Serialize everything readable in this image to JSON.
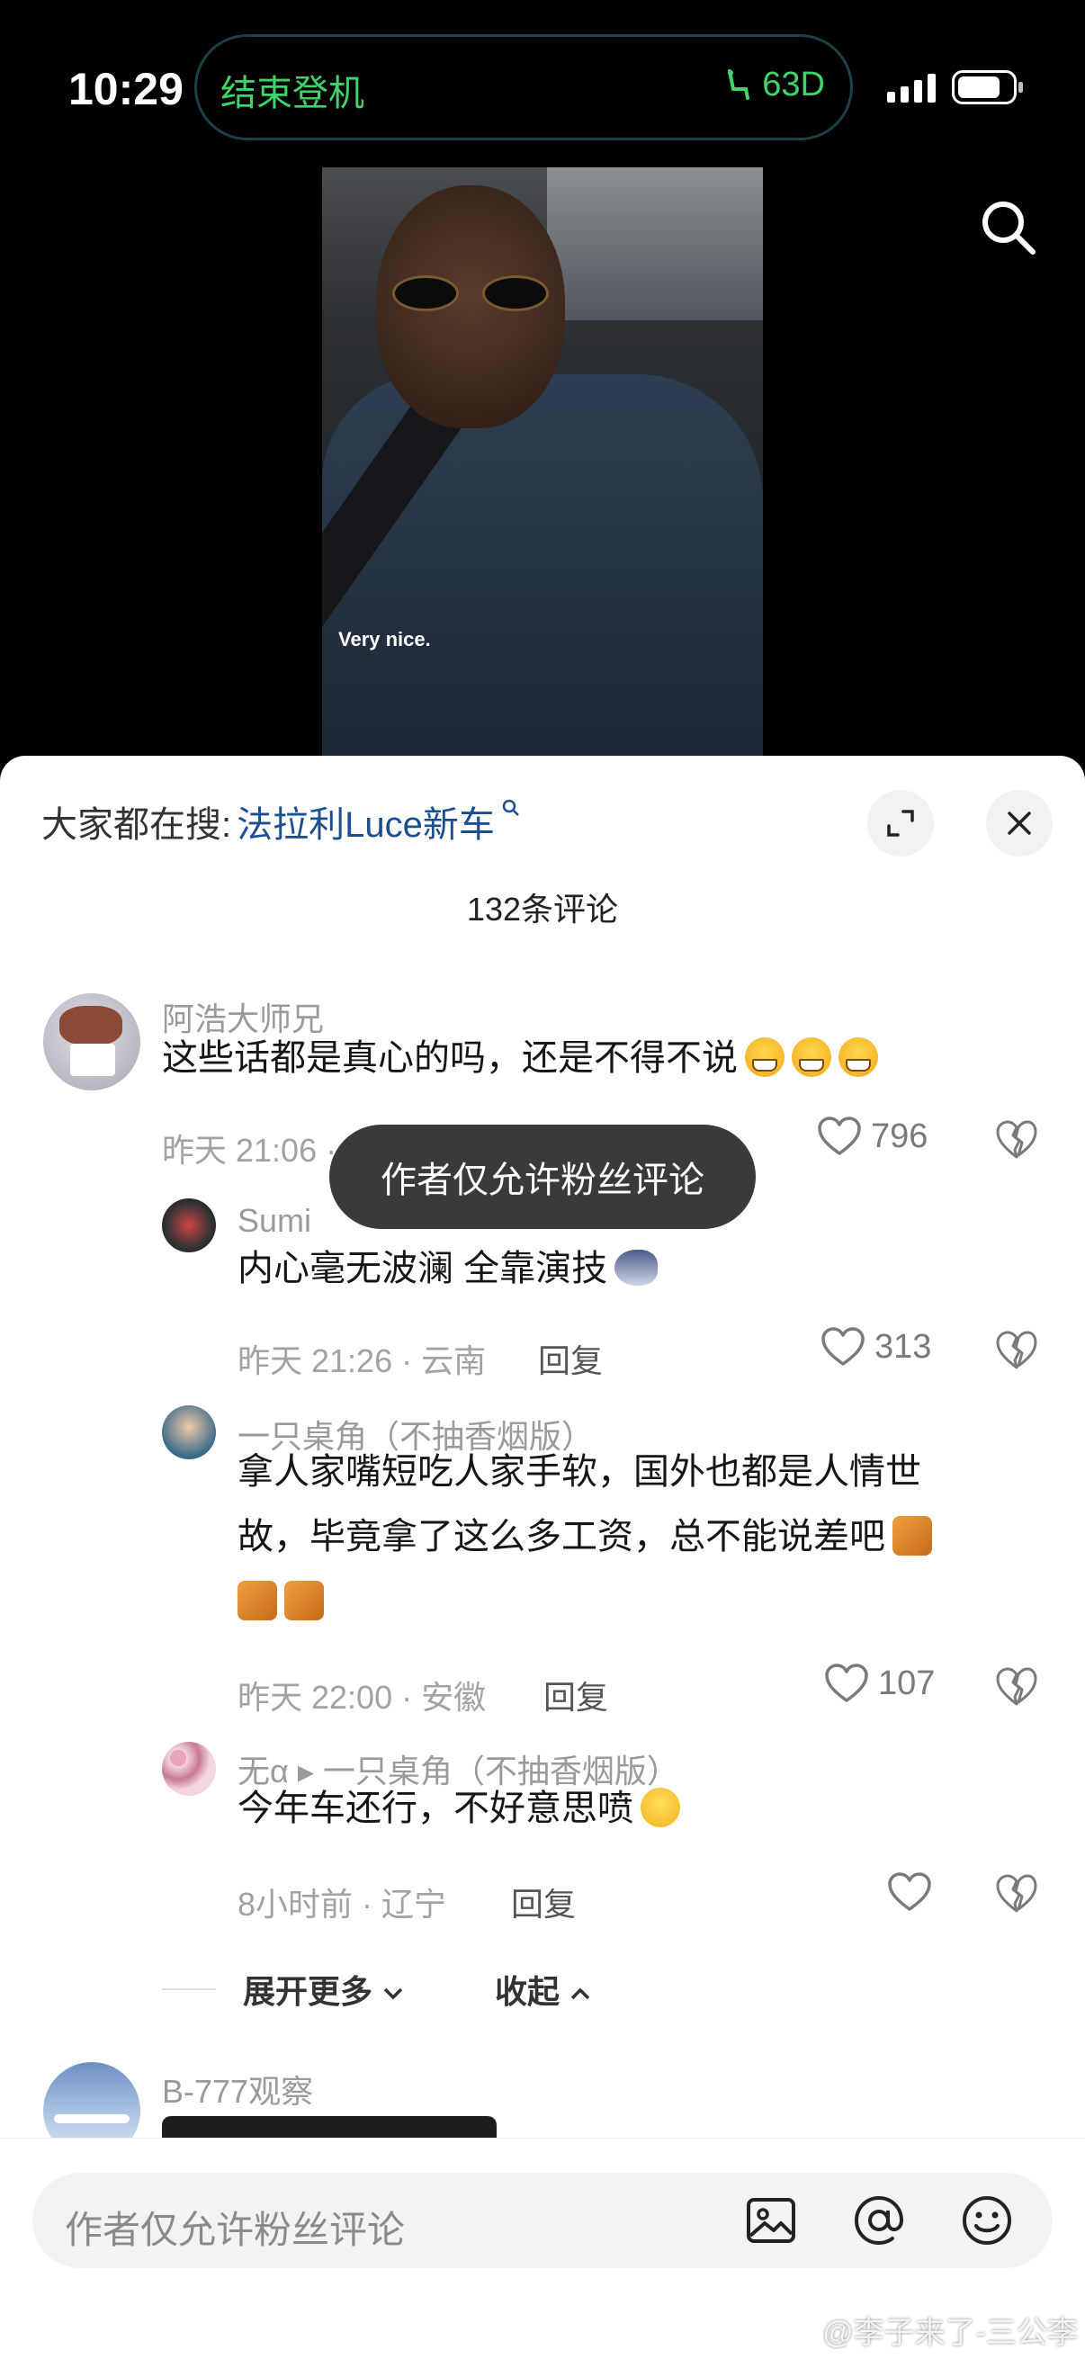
{
  "status": {
    "time": "10:29",
    "island_text": "结束登机",
    "seat": "63D"
  },
  "video": {
    "caption": "Very nice."
  },
  "sheet": {
    "hot_search_label": "大家都在搜:",
    "hot_search_term": "法拉利Luce新车",
    "comment_count": "132条评论",
    "toast": "作者仅允许粉丝评论"
  },
  "comments": [
    {
      "name": "阿浩大师兄",
      "text": "这些话都是真心的吗，还是不得不说",
      "meta": "昨天 21:06 ·",
      "likes": "796"
    },
    {
      "name": "Sumi",
      "text": "内心毫无波澜 全靠演技",
      "meta": "昨天 21:26 · 云南",
      "reply": "回复",
      "likes": "313"
    },
    {
      "name": "一只桌角（不抽香烟版）",
      "text_line1": "拿人家嘴短吃人家手软，国外也都是人情世",
      "text_line2": "故，毕竟拿了这么多工资，总不能说差吧",
      "meta": "昨天 22:00 · 安徽",
      "reply": "回复",
      "likes": "107"
    },
    {
      "name": "无α ▸ 一只桌角（不抽香烟版）",
      "text": "今年车还行，不好意思喷",
      "meta": "8小时前 · 辽宁",
      "reply": "回复"
    },
    {
      "name": "B-777观察"
    }
  ],
  "expand": {
    "more": "展开更多",
    "collapse": "收起"
  },
  "input": {
    "placeholder": "作者仅允许粉丝评论"
  },
  "watermark": "@李子来了-三公李",
  "icons": {
    "search": "search-icon",
    "expand": "fullscreen-icon",
    "close": "close-icon",
    "like": "heart-icon",
    "dislike": "broken-heart-icon",
    "image": "image-icon",
    "mention": "at-icon",
    "emoji": "emoji-icon"
  }
}
